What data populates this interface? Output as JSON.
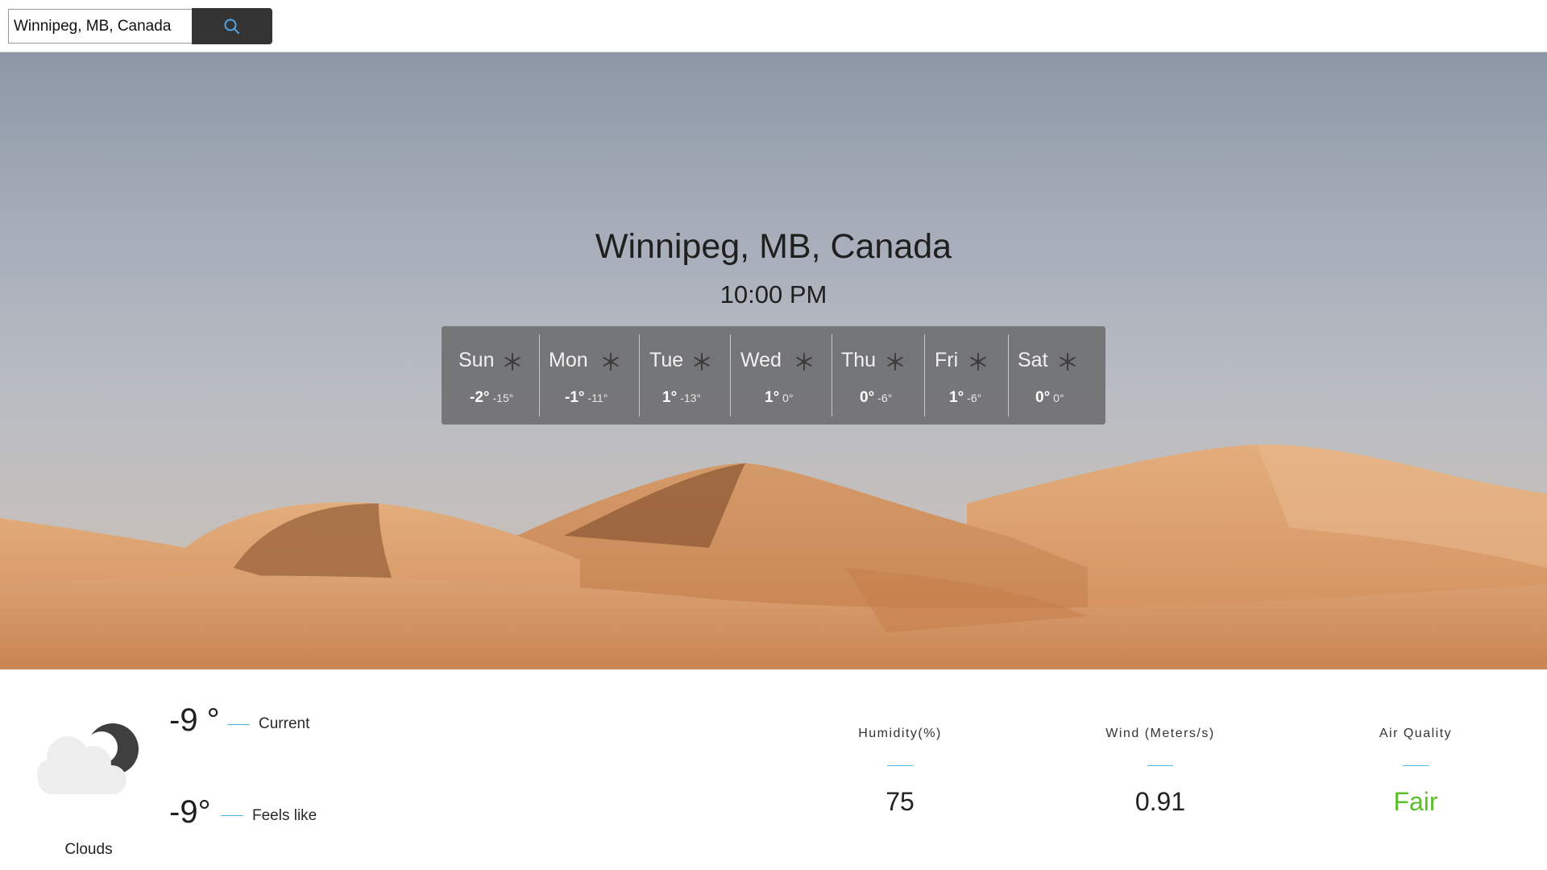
{
  "search": {
    "value": "Winnipeg, MB, Canada",
    "icon": "search-icon"
  },
  "header": {
    "city": "Winnipeg, MB, Canada",
    "time": "10:00 PM"
  },
  "forecast": [
    {
      "day": "Sun",
      "hi": "-2°",
      "lo": "-15°",
      "icon": "snowflake-icon"
    },
    {
      "day": "Mon",
      "hi": "-1°",
      "lo": "-11°",
      "icon": "snowflake-icon"
    },
    {
      "day": "Tue",
      "hi": "1°",
      "lo": "-13°",
      "icon": "snowflake-icon"
    },
    {
      "day": "Wed",
      "hi": "1°",
      "lo": "0°",
      "icon": "snowflake-icon"
    },
    {
      "day": "Thu",
      "hi": "0°",
      "lo": "-6°",
      "icon": "snowflake-icon"
    },
    {
      "day": "Fri",
      "hi": "1°",
      "lo": "-6°",
      "icon": "snowflake-icon"
    },
    {
      "day": "Sat",
      "hi": "0°",
      "lo": "0°",
      "icon": "snowflake-icon"
    }
  ],
  "current": {
    "condition": "Clouds",
    "condition_icon": "cloudy-night-icon",
    "temperature": "-9 °",
    "temperature_label": "Current",
    "feels_like": "-9°",
    "feels_like_label": "Feels like"
  },
  "stats": {
    "humidity_title": "Humidity(%)",
    "humidity_value": "75",
    "wind_title": "Wind (Meters/s)",
    "wind_value": "0.91",
    "air_quality_title": "Air Quality",
    "air_quality_value": "Fair"
  },
  "colors": {
    "accent_line": "#4fb8e0",
    "air_quality_fair": "#5bbf2c",
    "search_button": "#343434"
  }
}
